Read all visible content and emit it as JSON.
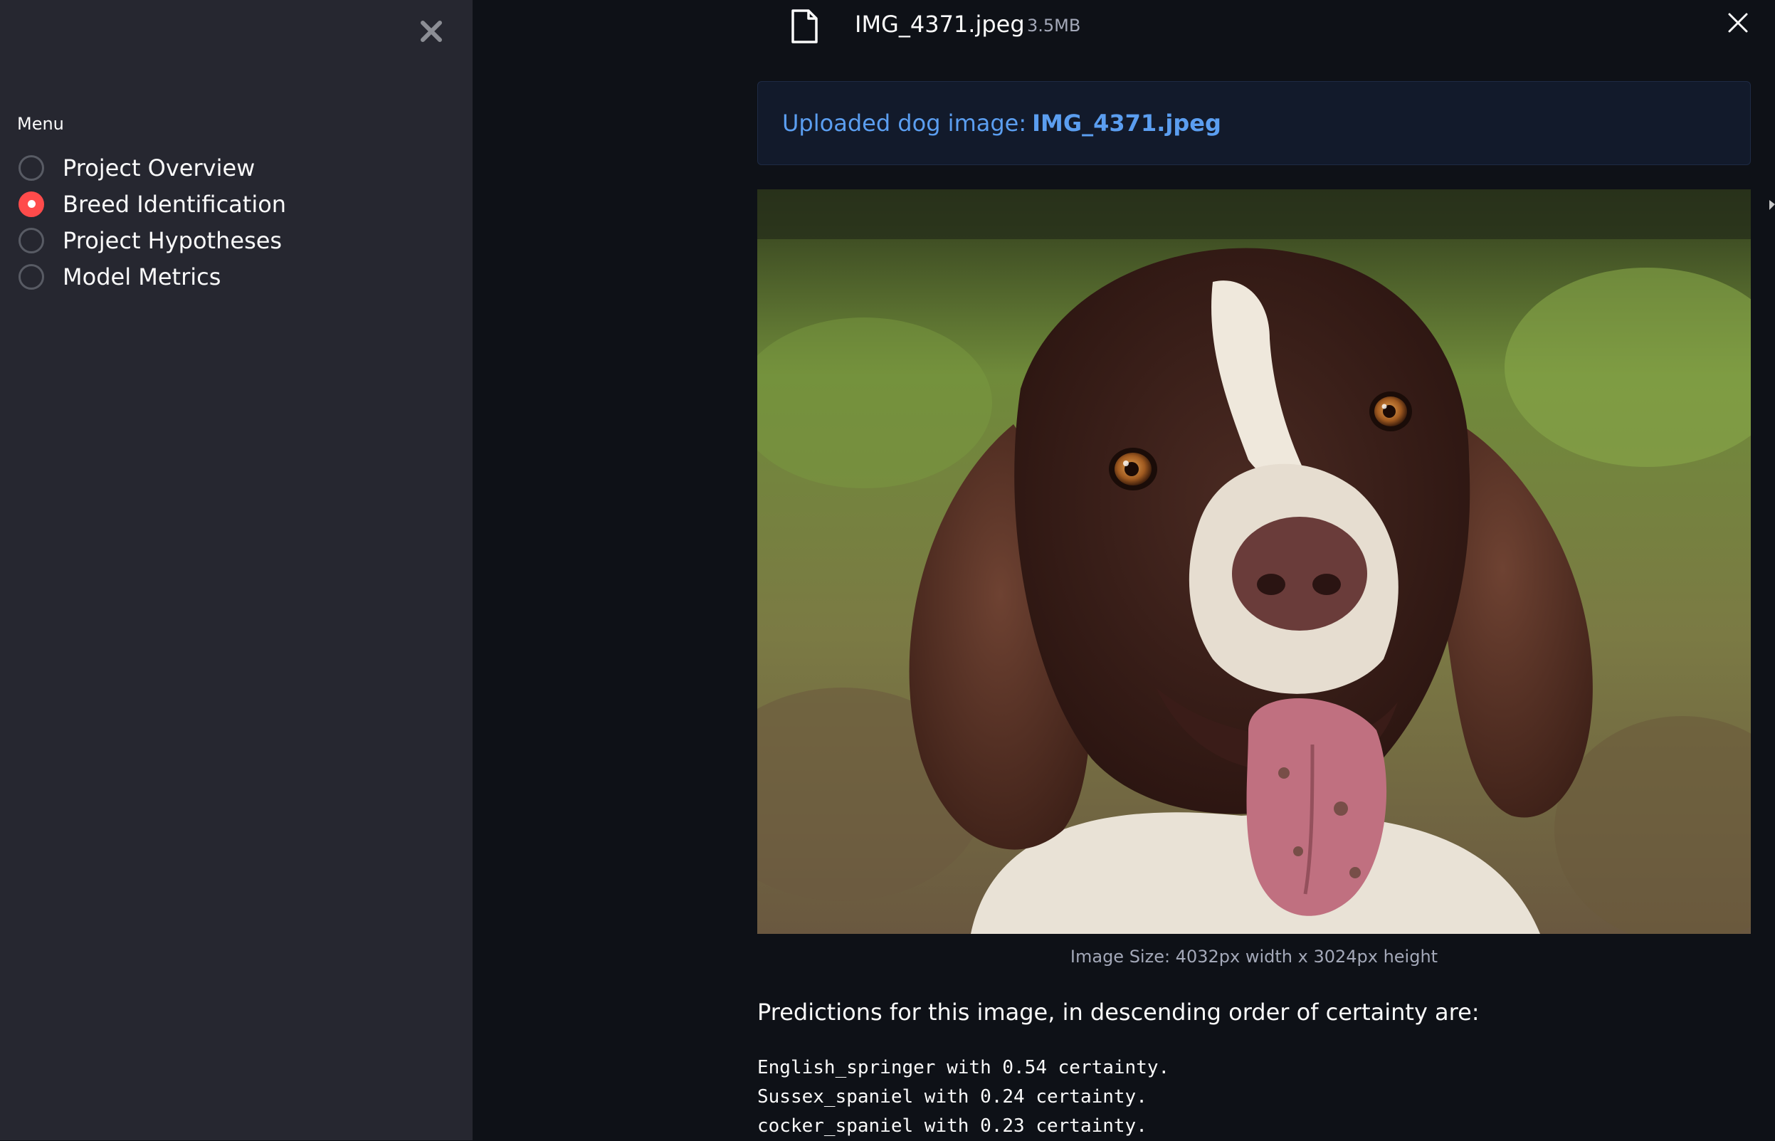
{
  "sidebar": {
    "menu_title": "Menu",
    "close_icon": "close-x-icon",
    "items": [
      {
        "label": "Project Overview",
        "selected": false
      },
      {
        "label": "Breed Identification",
        "selected": true
      },
      {
        "label": "Project Hypotheses",
        "selected": false
      },
      {
        "label": "Model Metrics",
        "selected": false
      }
    ],
    "accent_color": "#ff4b4b"
  },
  "file": {
    "name": "IMG_4371.jpeg",
    "size": "3.5MB",
    "icon": "file-icon",
    "remove_icon": "close-icon"
  },
  "info": {
    "prefix": "Uploaded dog image:",
    "filename": "IMG_4371.jpeg",
    "color": "#5b9ef0"
  },
  "image": {
    "alt": "English springer spaniel face",
    "caption": "Image Size: 4032px width x 3024px height"
  },
  "predictions": {
    "heading": "Predictions for this image, in descending order of certainty are:",
    "items": [
      {
        "line": "English_springer with 0.54 certainty."
      },
      {
        "line": "Sussex_spaniel with 0.24 certainty."
      },
      {
        "line": "cocker_spaniel with 0.23 certainty."
      }
    ]
  }
}
